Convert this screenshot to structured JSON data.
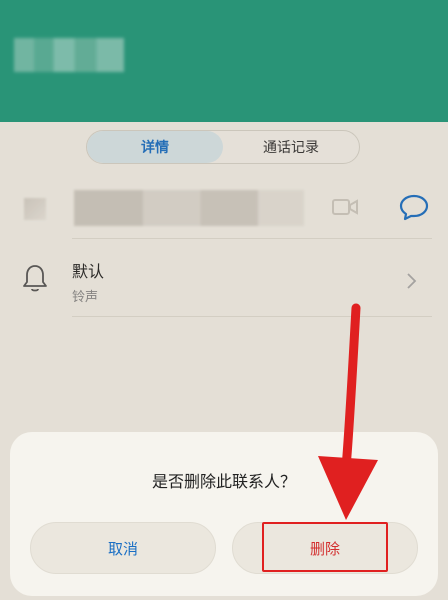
{
  "tabs": {
    "details": "详情",
    "call_log": "通话记录"
  },
  "ringtone": {
    "title": "默认",
    "subtitle": "铃声"
  },
  "dialog": {
    "message": "是否删除此联系人？",
    "cancel_label": "取消",
    "delete_label": "删除"
  },
  "icons": {
    "video": "video-call-icon",
    "message": "message-icon",
    "bell": "bell-icon",
    "chevron": "chevron-right-icon",
    "arrow": "red-arrow-annotation"
  },
  "colors": {
    "header": "#1e9a7c",
    "accent_blue": "#1a6fc4",
    "delete_red": "#d32f2f",
    "annotation_red": "#e02020"
  }
}
